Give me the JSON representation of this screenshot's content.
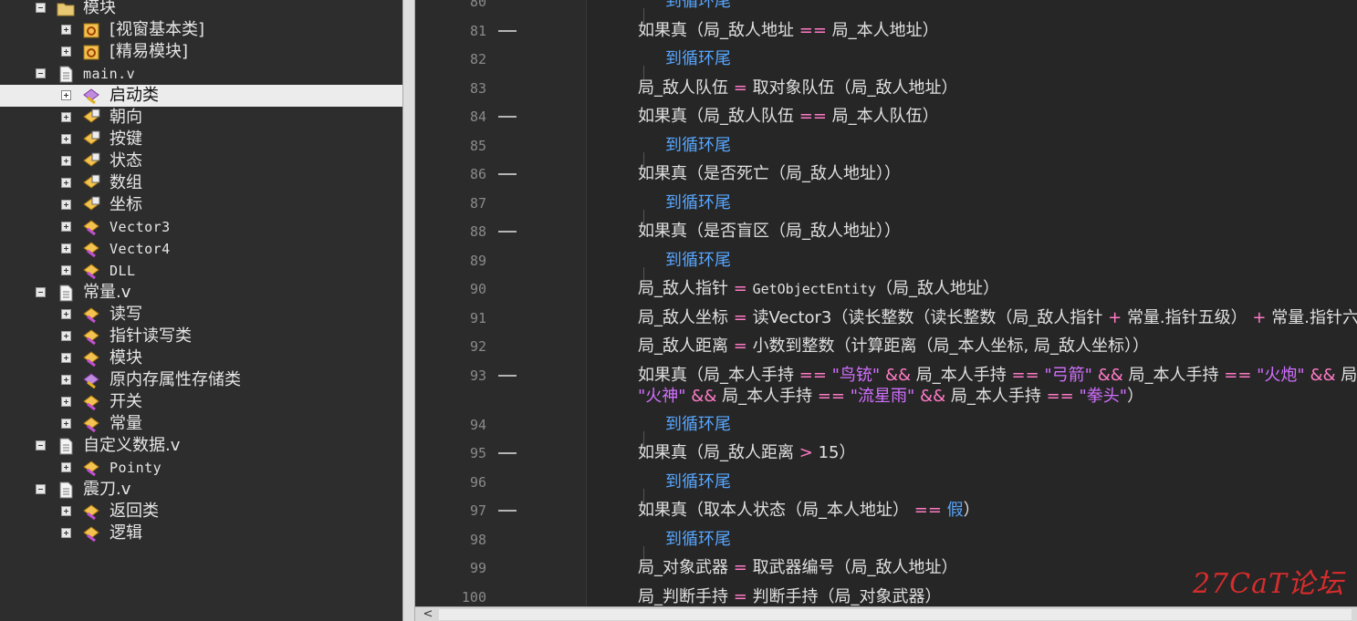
{
  "tree": {
    "items": [
      {
        "label": "模块",
        "icon": "folder-icon",
        "toggle": "minus"
      },
      {
        "label": "[视窗基本类]",
        "icon": "library-icon",
        "toggle": "plus"
      },
      {
        "label": "[精易模块]",
        "icon": "library-icon",
        "toggle": "plus"
      },
      {
        "label": "main.v",
        "icon": "file-icon",
        "toggle": "minus"
      },
      {
        "label": "启动类",
        "icon": "class-icon",
        "toggle": "plus",
        "selected": true
      },
      {
        "label": "朝向",
        "icon": "class-icon",
        "toggle": "plus"
      },
      {
        "label": "按键",
        "icon": "class-icon",
        "toggle": "plus"
      },
      {
        "label": "状态",
        "icon": "class-icon",
        "toggle": "plus"
      },
      {
        "label": "数组",
        "icon": "class-icon",
        "toggle": "plus"
      },
      {
        "label": "坐标",
        "icon": "class-icon",
        "toggle": "plus"
      },
      {
        "label": "Vector3",
        "icon": "class-icon",
        "toggle": "plus"
      },
      {
        "label": "Vector4",
        "icon": "class-icon",
        "toggle": "plus"
      },
      {
        "label": "DLL",
        "icon": "class-icon",
        "toggle": "plus"
      },
      {
        "label": "常量.v",
        "icon": "file-icon",
        "toggle": "minus"
      },
      {
        "label": "读写",
        "icon": "class-icon",
        "toggle": "plus"
      },
      {
        "label": "指针读写类",
        "icon": "class-icon",
        "toggle": "plus"
      },
      {
        "label": "模块",
        "icon": "class-icon",
        "toggle": "plus"
      },
      {
        "label": "原内存属性存储类",
        "icon": "class-icon",
        "toggle": "plus"
      },
      {
        "label": "开关",
        "icon": "class-icon",
        "toggle": "plus"
      },
      {
        "label": "常量",
        "icon": "class-icon",
        "toggle": "plus"
      },
      {
        "label": "自定义数据.v",
        "icon": "file-icon",
        "toggle": "minus"
      },
      {
        "label": "Pointy",
        "icon": "class-icon",
        "toggle": "plus"
      },
      {
        "label": "震刀.v",
        "icon": "file-icon",
        "toggle": "minus"
      },
      {
        "label": "返回类",
        "icon": "class-icon",
        "toggle": "plus"
      },
      {
        "label": "逻辑",
        "icon": "class-icon",
        "toggle": "plus"
      }
    ]
  },
  "editor": {
    "line_numbers": [
      "80",
      "81",
      "82",
      "83",
      "84",
      "85",
      "86",
      "87",
      "88",
      "89",
      "90",
      "91",
      "92",
      "93",
      "94",
      "95",
      "96",
      "97",
      "98",
      "99",
      "100"
    ],
    "partial_top": "到循环尾",
    "code": {
      "l81": [
        "如果真",
        "（局_敌人地址",
        "==",
        "局_本人地址）"
      ],
      "l82": "到循环尾",
      "l83": [
        "局_敌人队伍",
        "=",
        "取对象队伍（局_敌人地址）"
      ],
      "l84": [
        "如果真",
        "（局_敌人队伍",
        "==",
        "局_本人队伍）"
      ],
      "l85": "到循环尾",
      "l86": [
        "如果真",
        "（是否死亡（局_敌人地址））"
      ],
      "l87": "到循环尾",
      "l88": [
        "如果真",
        "（是否盲区（局_敌人地址））"
      ],
      "l89": "到循环尾",
      "l90": [
        "局_敌人指针",
        "=",
        "GetObjectEntity",
        "（局_敌人地址）"
      ],
      "l91": [
        "局_敌人坐标",
        "=",
        "读Vector3",
        "（读长整数（读长整数（局_敌人指针",
        "+",
        "常量.指针五级）",
        "+",
        "常量.指针六级"
      ],
      "l92": [
        "局_敌人距离",
        "=",
        "小数到整数（计算距离（局_本人坐标, 局_敌人坐标））"
      ],
      "l93a": [
        "如果真",
        "（局_本人手持",
        "==",
        "\"鸟铳\"",
        "&&",
        "局_本人手持",
        "==",
        "\"弓箭\"",
        "&&",
        "局_本人手持",
        "==",
        "\"火炮\"",
        "&&",
        "局_本"
      ],
      "l93b": [
        "\"火神\"",
        "&&",
        "局_本人手持",
        "==",
        "\"流星雨\"",
        "&&",
        "局_本人手持",
        "==",
        "\"拳头\"",
        "）"
      ],
      "l94": "到循环尾",
      "l95": [
        "如果真",
        "（局_敌人距离",
        ">",
        "15）"
      ],
      "l96": "到循环尾",
      "l97": [
        "如果真",
        "（取本人状态（局_本人地址）",
        "==",
        "假",
        "）"
      ],
      "l98": "到循环尾",
      "l99": [
        "局_对象武器",
        "=",
        "取武器编号（局_敌人地址）"
      ],
      "l100": [
        "局_判断手持",
        "=",
        "判断手持（局_对象武器）"
      ]
    }
  },
  "scrollbar": {
    "left_arrow": "<"
  },
  "watermark": "27CaT论坛",
  "colors": {
    "keyword": "#57a6ff",
    "operator": "#ff7ac6",
    "string": "#d26fff",
    "watermark": "#d72c2c"
  }
}
